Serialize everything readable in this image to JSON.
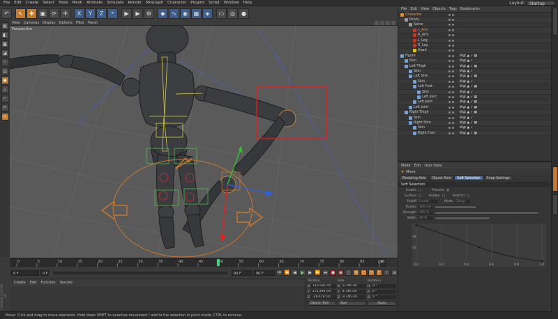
{
  "menubar": {
    "items": [
      "File",
      "Edit",
      "Create",
      "Select",
      "Tools",
      "Mesh",
      "Animate",
      "Simulate",
      "Render",
      "MoGraph",
      "Character",
      "Plugins",
      "Script",
      "Window",
      "Help"
    ],
    "layout_label": "Layout:",
    "layout_value": "Startup"
  },
  "toolbar": {
    "buttons": [
      {
        "name": "undo-icon",
        "glyph": "↶"
      },
      {
        "name": "live-selection-icon",
        "glyph": "↖",
        "active": true
      },
      {
        "name": "move-icon",
        "glyph": "✥",
        "active": true
      },
      {
        "name": "scale-icon",
        "glyph": "▣"
      },
      {
        "name": "rotate-icon",
        "glyph": "⟳"
      },
      {
        "name": "last-tool-icon",
        "glyph": "✛"
      },
      {
        "name": "x-axis-icon",
        "glyph": "X",
        "blue": true
      },
      {
        "name": "y-axis-icon",
        "glyph": "Y",
        "blue": true
      },
      {
        "name": "z-axis-icon",
        "glyph": "Z",
        "blue": true
      },
      {
        "name": "coord-system-icon",
        "glyph": "⌖",
        "blue": true
      },
      {
        "name": "render-view-icon",
        "glyph": "▶"
      },
      {
        "name": "render-picture-icon",
        "glyph": "▶"
      },
      {
        "name": "render-settings-icon",
        "glyph": "⚙"
      },
      {
        "name": "cube-icon",
        "glyph": "◆",
        "blue": true
      },
      {
        "name": "spline-icon",
        "glyph": "∿",
        "blue": true
      },
      {
        "name": "nurbs-icon",
        "glyph": "◉",
        "blue": true
      },
      {
        "name": "array-icon",
        "glyph": "▦",
        "blue": true
      },
      {
        "name": "deformer-icon",
        "glyph": "◈",
        "blue": true
      },
      {
        "name": "scene-icon",
        "glyph": "▭"
      },
      {
        "name": "camera-icon",
        "glyph": "◎"
      },
      {
        "name": "light-icon",
        "glyph": "●"
      }
    ]
  },
  "viewport": {
    "menu": [
      "View",
      "Cameras",
      "Display",
      "Options",
      "Filter",
      "Panel"
    ],
    "label": "Perspective"
  },
  "timeline": {
    "ticks": [
      "0",
      "5",
      "10",
      "15",
      "20",
      "25",
      "30",
      "35",
      "40",
      "45",
      "50",
      "55",
      "60",
      "65",
      "70",
      "75",
      "80",
      "85",
      "90"
    ],
    "end_label": "0 F",
    "start_frame": "0 F",
    "min_frame": "0 F",
    "end_frame": "90 F",
    "max_frame": "90 F"
  },
  "material_panel": {
    "menu": [
      "Create",
      "Edit",
      "Function",
      "Texture"
    ]
  },
  "coordinates": {
    "headers": [
      "Position",
      "Size",
      "Rotation"
    ],
    "rows": [
      [
        "X",
        "113.581 cm",
        "X",
        "8.746 cm",
        "H",
        "0 °"
      ],
      [
        "Y",
        "175.294 cm",
        "Y",
        "8.746 cm",
        "P",
        "0 °"
      ],
      [
        "Z",
        "-26.479 cm",
        "Z",
        "8.746 cm",
        "B",
        "0 °"
      ]
    ],
    "mode": "Object (Rel)",
    "size_mode": "Size",
    "apply": "Apply"
  },
  "brand": "MAXON CINEMA 4D",
  "statusbar": "Move: Click and drag to move elements. Hold down SHIFT to quantize movement / add to the selection in point mode, CTRL to remove.",
  "objects": {
    "menu": [
      "File",
      "Edit",
      "View",
      "Objects",
      "Tags",
      "Bookmarks"
    ],
    "rows": [
      {
        "label": "Character",
        "indent": 0,
        "color": "#e08a2a",
        "state": "sel",
        "tags": ""
      },
      {
        "label": "Pelvis",
        "indent": 1,
        "color": "#9a9a9a",
        "tags": ""
      },
      {
        "label": "Spine",
        "indent": 2,
        "color": "#9a9a9a",
        "tags": ""
      },
      {
        "label": "L_Arm",
        "indent": 3,
        "color": "#c0392b",
        "state": "selr",
        "tags": ""
      },
      {
        "label": "R_Arm",
        "indent": 3,
        "color": "#c0392b",
        "tags": ""
      },
      {
        "label": "L_Leg",
        "indent": 3,
        "color": "#c0392b",
        "tags": ""
      },
      {
        "label": "R_Leg",
        "indent": 3,
        "color": "#c0392b",
        "tags": ""
      },
      {
        "label": "Head",
        "indent": 3,
        "color": "#e0c020",
        "tags": ""
      },
      {
        "label": "Figure",
        "indent": 0,
        "color": "#7aa0d0",
        "tags": "Wgt ▲ ✓ ▦"
      },
      {
        "label": "Skin",
        "indent": 1,
        "color": "#7aa0d0",
        "tags": "Wgt ▲ ✓"
      },
      {
        "label": "Left Thigh",
        "indent": 1,
        "color": "#7aa0d0",
        "tags": "Wgt ▲ ✓ ▦"
      },
      {
        "label": "Skin",
        "indent": 2,
        "color": "#7aa0d0",
        "tags": "Wgt ▲ ✓"
      },
      {
        "label": "Left Shin",
        "indent": 2,
        "color": "#7aa0d0",
        "tags": "Wgt ▲ ✓ ▦"
      },
      {
        "label": "Skin",
        "indent": 3,
        "color": "#7aa0d0",
        "tags": "Wgt ▲ ✓"
      },
      {
        "label": "Left Foot",
        "indent": 3,
        "color": "#7aa0d0",
        "tags": "Wgt ▲ ✓ ▦"
      },
      {
        "label": "Skin",
        "indent": 4,
        "color": "#7aa0d0",
        "tags": "Wgt ▲ ✓"
      },
      {
        "label": "Left Joint",
        "indent": 4,
        "color": "#7aa0d0",
        "tags": "Wgt ▲ ✓ ▦"
      },
      {
        "label": "Left Joint",
        "indent": 3,
        "color": "#7aa0d0",
        "tags": "Wgt ▲ ✓ ▦"
      },
      {
        "label": "Left Joint",
        "indent": 2,
        "color": "#7aa0d0",
        "tags": "Wgt ▲ ✓ ▦"
      },
      {
        "label": "Right Thigh",
        "indent": 1,
        "color": "#7aa0d0",
        "tags": "Wgt ▲ ✓ ▦"
      },
      {
        "label": "Skin",
        "indent": 2,
        "color": "#7aa0d0",
        "tags": "Wgt ▲ ✓"
      },
      {
        "label": "Right Shin",
        "indent": 2,
        "color": "#7aa0d0",
        "tags": "Wgt ▲ ✓ ▦"
      },
      {
        "label": "Skin",
        "indent": 3,
        "color": "#7aa0d0",
        "tags": "Wgt ▲ ✓"
      },
      {
        "label": "Right Foot",
        "indent": 3,
        "color": "#7aa0d0",
        "tags": "Wgt ▲ ✓ ▦"
      }
    ]
  },
  "attributes": {
    "menu": [
      "Mode",
      "Edit",
      "User Data"
    ],
    "title": "Move",
    "tabs": [
      {
        "label": "Modeling Axis",
        "active": false
      },
      {
        "label": "Object Axis",
        "active": false
      },
      {
        "label": "Soft Selection",
        "active": true
      },
      {
        "label": "Snap Settings",
        "active": false
      }
    ],
    "section": "Soft Selection",
    "enable": "Enable",
    "preview": "Preview",
    "surface": "Surface",
    "rubber": "Rubber",
    "restrict": "Restrict",
    "falloff_label": "Falloff",
    "falloff_value": "Linear",
    "mode_label": "Mode",
    "mode_value": "Group",
    "radius_label": "Radius",
    "radius_value": "100 cm",
    "strength_label": "Strength",
    "strength_value": "100 %",
    "width_label": "Width",
    "width_value": "50 %",
    "graph_y_ticks": [
      "1",
      "0.8",
      "0.6"
    ],
    "graph_x_ticks": [
      "0.0",
      "0.2",
      "0.4",
      "0.6",
      "0.8",
      "1.0"
    ]
  },
  "colors": {
    "accent": "#c47a2a",
    "selection_tab": "#3d6fb0",
    "highlight_box": "#e02020",
    "viewport_bg": "#5a5a5a"
  }
}
